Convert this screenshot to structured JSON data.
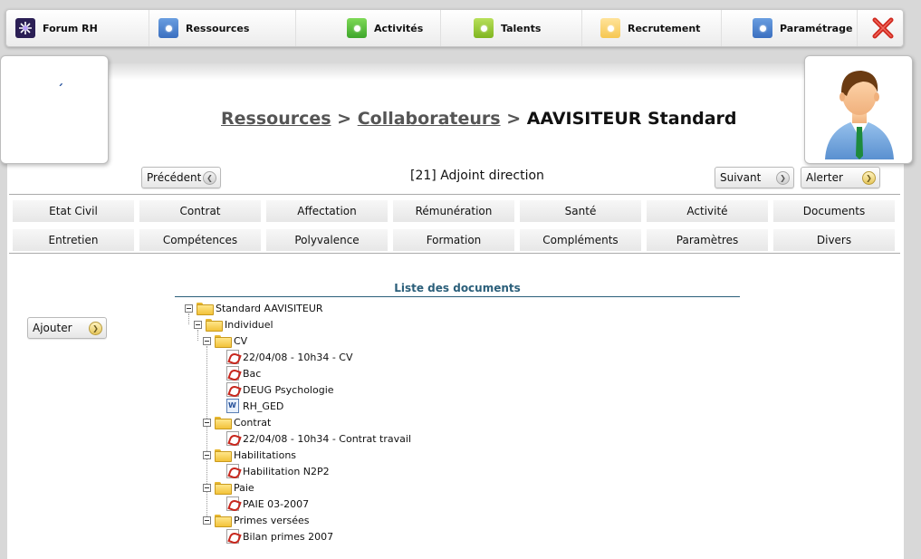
{
  "nav": {
    "items": [
      {
        "label": "Forum RH",
        "icon": "forum-icon"
      },
      {
        "label": "Ressources",
        "icon": "ressources-icon"
      },
      {
        "label": "Activités",
        "icon": "activites-icon"
      },
      {
        "label": "Talents",
        "icon": "talents-icon"
      },
      {
        "label": "Recrutement",
        "icon": "recrutement-icon"
      },
      {
        "label": "Paramétrage",
        "icon": "parametrage-icon"
      }
    ],
    "close_icon": "close-icon",
    "close_color": "#d0281e"
  },
  "breadcrumb": {
    "part1": "Ressources",
    "sep1": " > ",
    "part2": "Collaborateurs",
    "sep2": " > ",
    "current": "AAVISITEUR Standard"
  },
  "logo": {
    "mark": "´"
  },
  "employee": {
    "post": "[21] Adjoint direction"
  },
  "buttons": {
    "prev": "Précédent",
    "next": "Suivant",
    "alert": "Alerter",
    "add": "Ajouter"
  },
  "tabs": {
    "row1": [
      "Etat Civil",
      "Contrat",
      "Affectation",
      "Rémunération",
      "Santé",
      "Activité",
      "Documents"
    ],
    "row2": [
      "Entretien",
      "Compétences",
      "Polyvalence",
      "Formation",
      "Compléments",
      "Paramètres",
      "Divers"
    ]
  },
  "documents": {
    "title": "Liste des documents",
    "tree": [
      {
        "label": "Standard AAVISITEUR",
        "type": "folder"
      },
      {
        "label": "Individuel",
        "type": "folder"
      },
      {
        "label": "CV",
        "type": "folder"
      },
      {
        "label": "22/04/08 - 10h34 - CV",
        "type": "pdf"
      },
      {
        "label": "Bac",
        "type": "pdf"
      },
      {
        "label": "DEUG Psychologie",
        "type": "pdf"
      },
      {
        "label": "RH_GED",
        "type": "word"
      },
      {
        "label": "Contrat",
        "type": "folder"
      },
      {
        "label": "22/04/08 - 10h34 - Contrat travail",
        "type": "pdf"
      },
      {
        "label": "Habilitations",
        "type": "folder"
      },
      {
        "label": "Habilitation N2P2",
        "type": "pdf"
      },
      {
        "label": "Paie",
        "type": "folder"
      },
      {
        "label": "PAIE 03-2007",
        "type": "pdf"
      },
      {
        "label": "Primes versées",
        "type": "folder"
      },
      {
        "label": "Bilan primes 2007",
        "type": "pdf"
      }
    ]
  }
}
